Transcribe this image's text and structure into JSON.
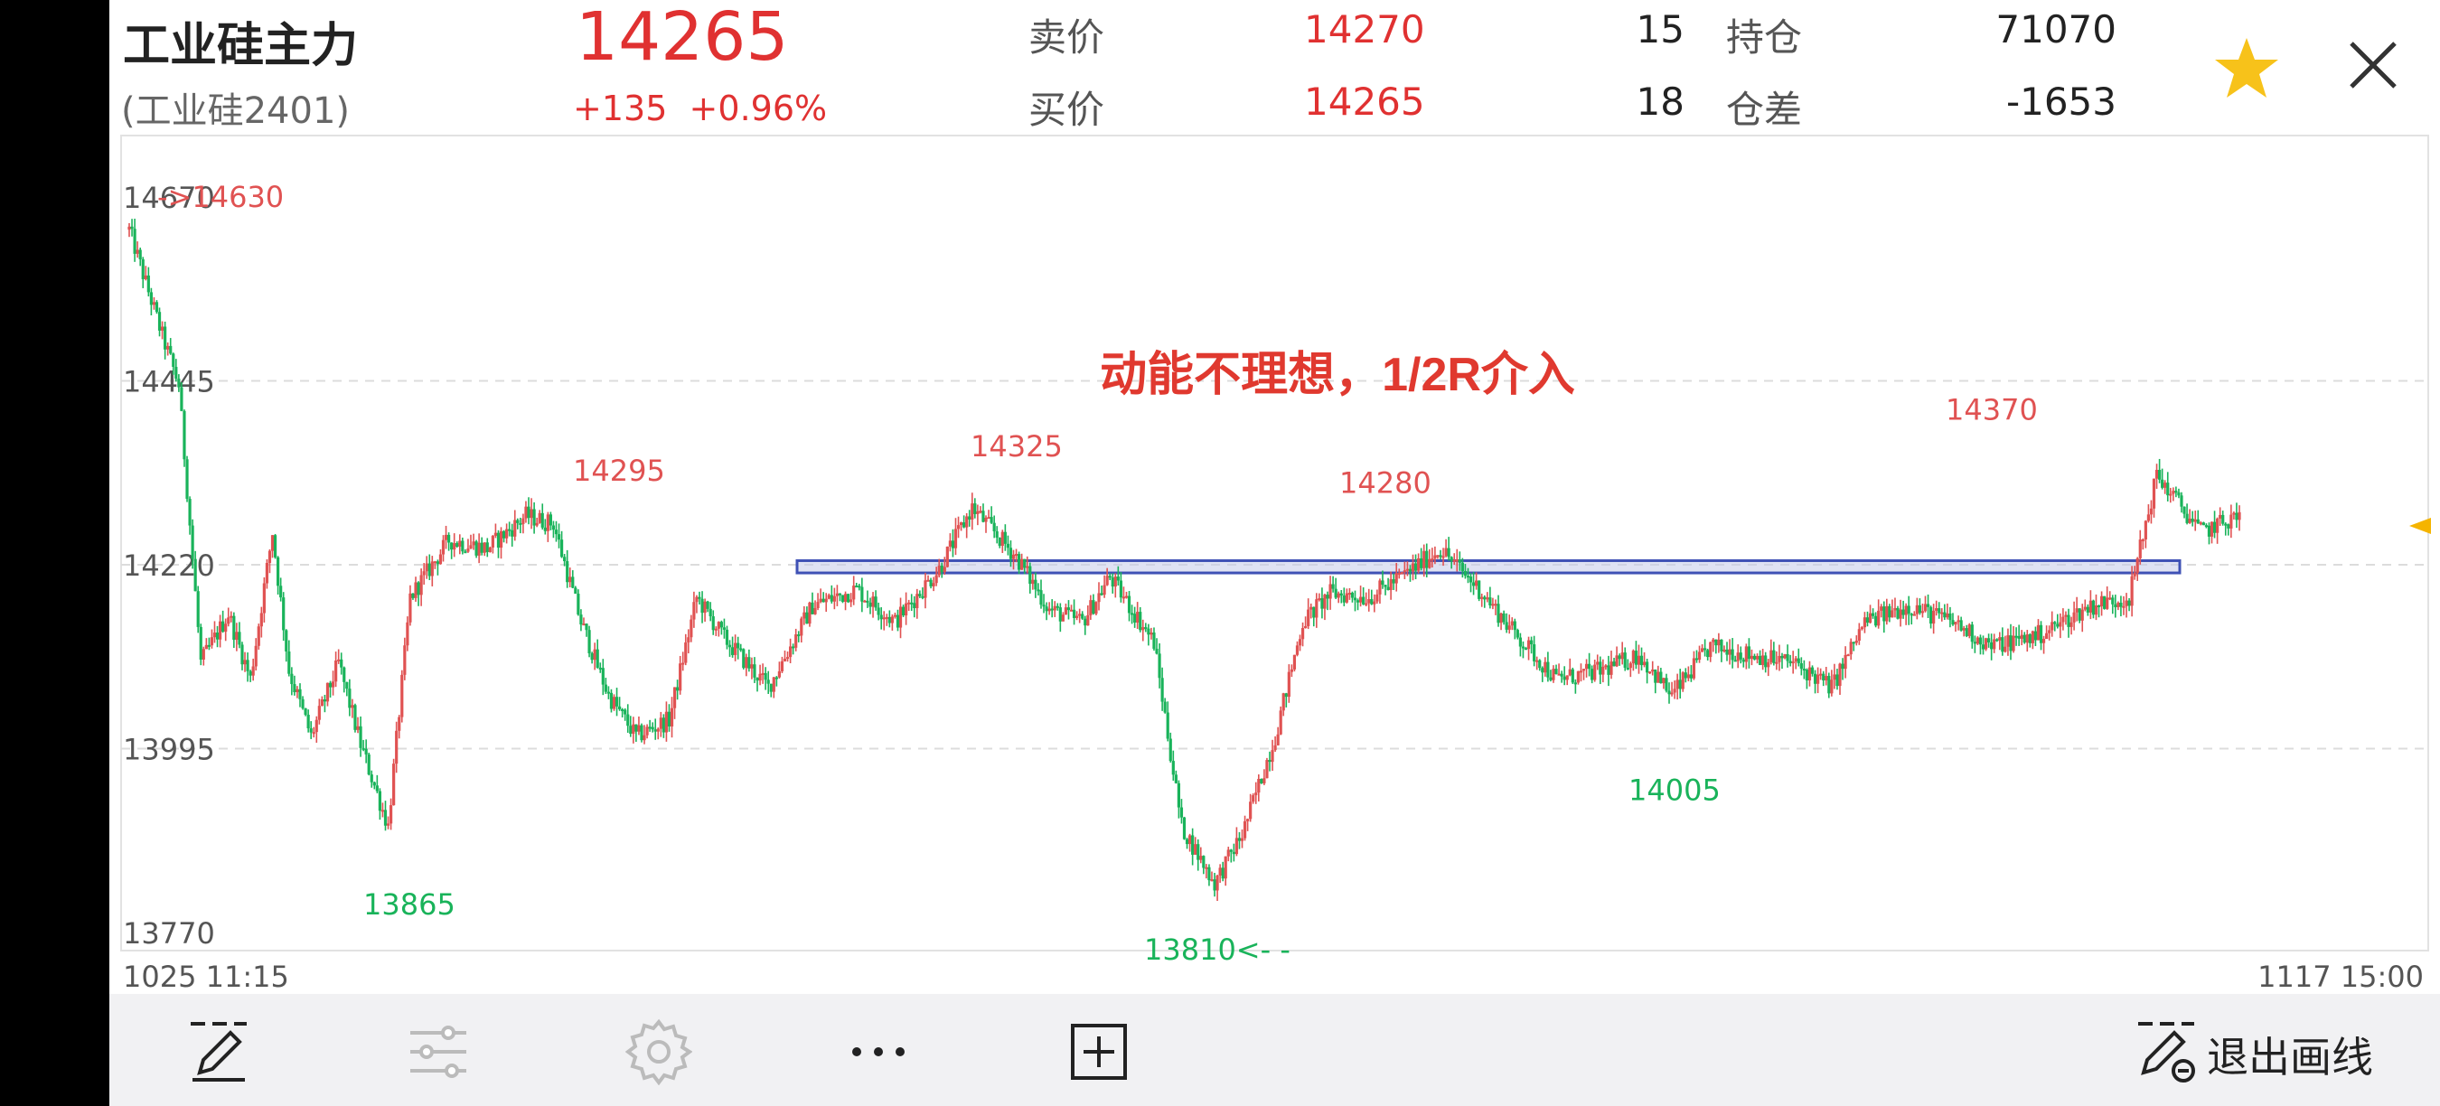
{
  "header": {
    "title": "工业硅主力",
    "subtitle": "(工业硅2401)",
    "price": "14265",
    "change": "+135",
    "change_pct": "+0.96%",
    "ask_label": "卖价",
    "ask_price": "14270",
    "ask_vol": "15",
    "bid_label": "买价",
    "bid_price": "14265",
    "bid_vol": "18",
    "oi_label": "持仓",
    "oi_value": "71070",
    "oi_diff_label": "仓差",
    "oi_diff_value": "-1653"
  },
  "icons": {
    "favorite": "star-icon",
    "close": "close-icon"
  },
  "chart_data": {
    "type": "candlestick",
    "ylim": [
      13770,
      14670
    ],
    "y_ticks": [
      "14670",
      "14445",
      "14220",
      "13995",
      "13770"
    ],
    "x_start_label": "1025 11:15",
    "x_end_label": "1117 15:00",
    "annotation_text": "动能不理想，1/2R介入",
    "zone": [
      14210,
      14225
    ],
    "peak_labels": [
      {
        "text": "->14630",
        "value": 14630,
        "kind": "high"
      },
      {
        "text": "14295",
        "value": 14295,
        "kind": "high"
      },
      {
        "text": "14325",
        "value": 14325,
        "kind": "high"
      },
      {
        "text": "14280",
        "value": 14280,
        "kind": "high"
      },
      {
        "text": "14370",
        "value": 14370,
        "kind": "high"
      },
      {
        "text": "13865",
        "value": 13865,
        "kind": "low"
      },
      {
        "text": "13810<- -",
        "value": 13810,
        "kind": "low"
      },
      {
        "text": "14005",
        "value": 14005,
        "kind": "low"
      }
    ],
    "colors": {
      "up": "#e05252",
      "down": "#19b35a",
      "grid": "#dcdcdc",
      "zone": "#3f51b5"
    }
  },
  "toolbar": {
    "exit_label": "退出画线",
    "tools": [
      "draw-pen-icon",
      "sliders-icon",
      "gear-icon",
      "more-icon",
      "add-box-icon"
    ]
  }
}
